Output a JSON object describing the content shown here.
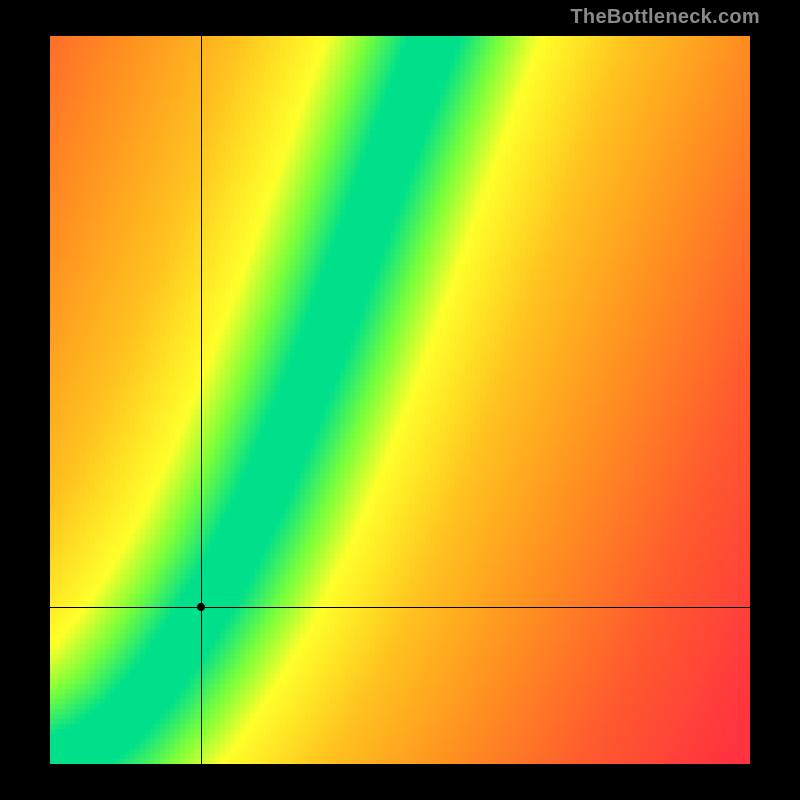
{
  "watermark": "TheBottleneck.com",
  "chart_data": {
    "type": "heatmap",
    "title": "",
    "xlabel": "",
    "ylabel": "",
    "x_range": [
      0,
      1
    ],
    "y_range": [
      0,
      1
    ],
    "grid": false,
    "legend": null,
    "colormap_stops": [
      {
        "d": 0.0,
        "color": "#00e08a"
      },
      {
        "d": 0.06,
        "color": "#7aff3a"
      },
      {
        "d": 0.12,
        "color": "#ffff2a"
      },
      {
        "d": 0.25,
        "color": "#ffc21f"
      },
      {
        "d": 0.4,
        "color": "#ff9420"
      },
      {
        "d": 0.6,
        "color": "#ff5a2e"
      },
      {
        "d": 0.8,
        "color": "#ff333f"
      },
      {
        "d": 1.0,
        "color": "#ff2a4a"
      }
    ],
    "ideal_curve": {
      "segments": [
        {
          "x": 0.0,
          "y": 0.0
        },
        {
          "x": 0.05,
          "y": 0.02
        },
        {
          "x": 0.1,
          "y": 0.055
        },
        {
          "x": 0.15,
          "y": 0.11
        },
        {
          "x": 0.2,
          "y": 0.18
        },
        {
          "x": 0.25,
          "y": 0.26
        },
        {
          "x": 0.3,
          "y": 0.36
        },
        {
          "x": 0.35,
          "y": 0.475
        },
        {
          "x": 0.4,
          "y": 0.6
        },
        {
          "x": 0.45,
          "y": 0.735
        },
        {
          "x": 0.5,
          "y": 0.87
        },
        {
          "x": 0.55,
          "y": 1.0
        }
      ]
    },
    "band_half_width": 0.035,
    "distance_scale": 0.9,
    "crosshair": {
      "x": 0.215,
      "y": 0.215
    },
    "marker": {
      "x": 0.215,
      "y": 0.215
    },
    "resolution": {
      "nx": 140,
      "ny": 146
    }
  }
}
